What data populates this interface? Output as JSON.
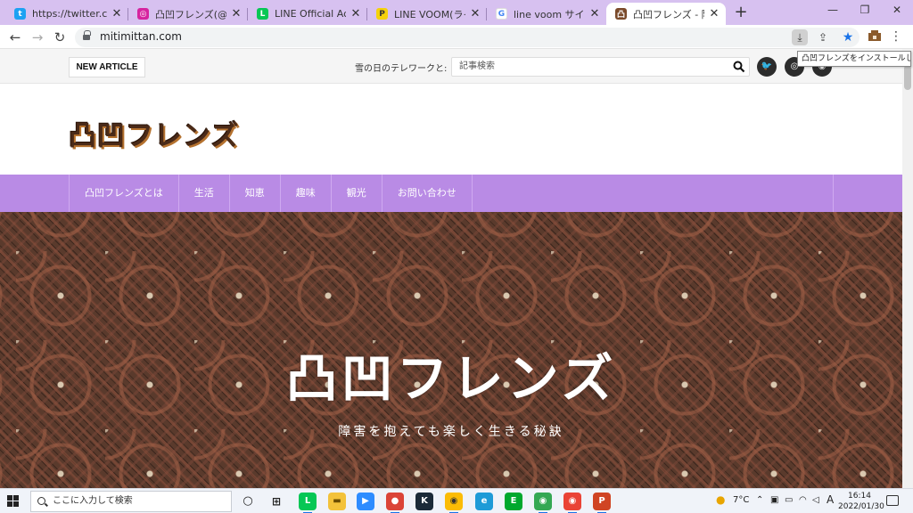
{
  "browser": {
    "tabs": [
      {
        "title": "https://twitter.com/",
        "icon": "twitter-icon",
        "color": "#1da1f2"
      },
      {
        "title": "凸凹フレンズ(@dekob",
        "icon": "instagram-icon",
        "color": "#d6249f"
      },
      {
        "title": "LINE Official Accoun",
        "icon": "line-icon",
        "color": "#06c755"
      },
      {
        "title": "LINE VOOM(ラインブ",
        "icon": "p-icon",
        "color": "#f5d20a"
      },
      {
        "title": "line voom サイズ - Go",
        "icon": "google-icon",
        "color": "#4285f4"
      },
      {
        "title": "凸凹フレンズ - 障害を抱",
        "icon": "site-icon",
        "color": "#7a4a2a"
      }
    ],
    "url": "mitimittan.com",
    "install_tooltip": "凸凹フレンズをインストールします"
  },
  "site": {
    "new_article_label": "NEW ARTICLE",
    "ticker": "雪の日のテレワークと:",
    "search_placeholder": "記事検索",
    "social": [
      "twitter-icon",
      "instagram-icon",
      "rss-icon"
    ],
    "logo": "凸凹フレンズ",
    "nav": [
      "凸凹フレンズとは",
      "生活",
      "知恵",
      "趣味",
      "観光",
      "お問い合わせ"
    ],
    "hero_title": "凸凹フレンズ",
    "hero_subtitle": "障害を抱えても楽しく生きる秘訣",
    "accent_color": "#b98be5"
  },
  "taskbar": {
    "search_placeholder": "ここに入力して検索",
    "weather": "7°C",
    "ime": "A",
    "time": "16:14",
    "date": "2022/01/30"
  }
}
